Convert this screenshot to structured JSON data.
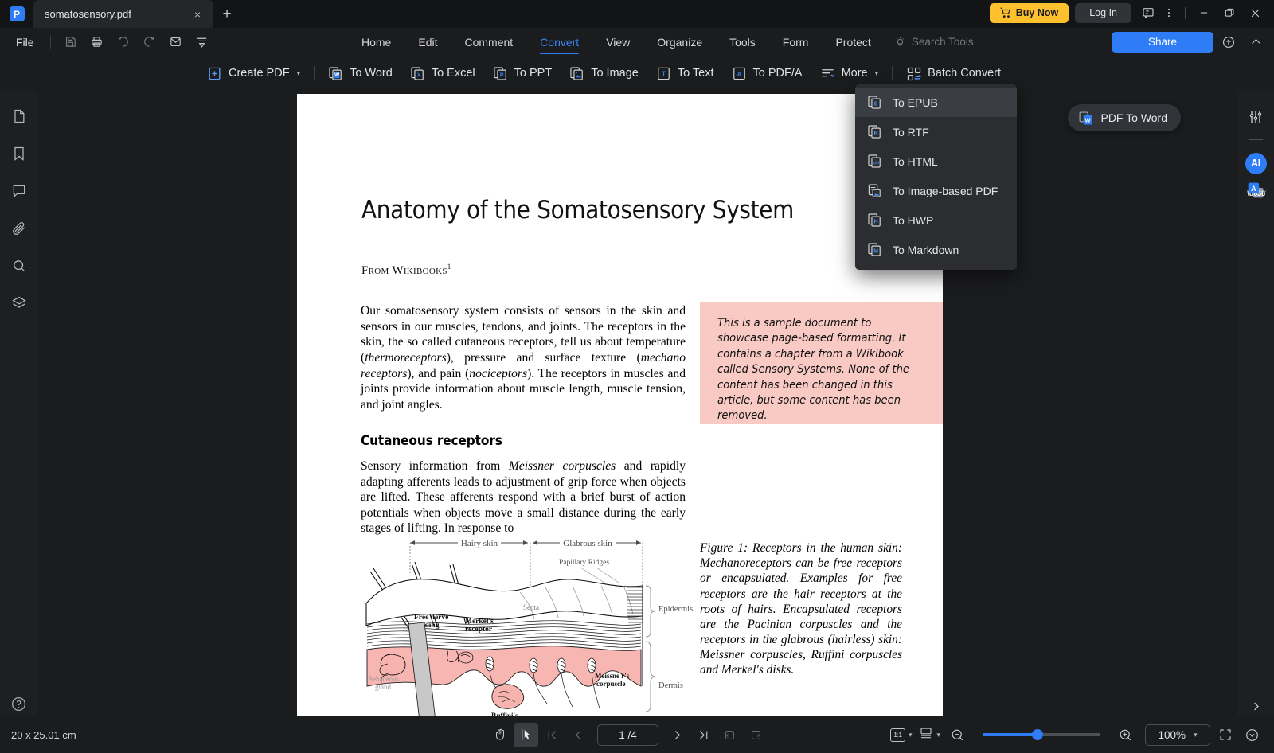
{
  "titlebar": {
    "app_logo": "pdfelement-logo-icon",
    "tab_title": "somatosensory.pdf",
    "tab_close": "×",
    "new_tab": "+",
    "buy_now": "Buy Now",
    "log_in": "Log In",
    "feedback_icon": "feedback-icon",
    "more_icon": "more-vertical-icon",
    "minimize": "−",
    "restore": "restore-icon",
    "close": "×"
  },
  "ribbon": {
    "file": "File",
    "quick_icons": [
      "save-icon",
      "print-icon",
      "undo-icon",
      "redo-icon",
      "email-icon",
      "customize-icon"
    ],
    "menus": [
      {
        "label": "Home",
        "selected": false
      },
      {
        "label": "Edit",
        "selected": false
      },
      {
        "label": "Comment",
        "selected": false
      },
      {
        "label": "Convert",
        "selected": true
      },
      {
        "label": "View",
        "selected": false
      },
      {
        "label": "Organize",
        "selected": false
      },
      {
        "label": "Tools",
        "selected": false
      },
      {
        "label": "Form",
        "selected": false
      },
      {
        "label": "Protect",
        "selected": false
      }
    ],
    "search_placeholder": "Search Tools",
    "search_icon": "lightbulb-icon",
    "share": "Share",
    "cloud_icon": "cloud-upload-icon",
    "collapse_icon": "chevron-up-icon"
  },
  "convert_toolbar": {
    "items": [
      {
        "label": "Create PDF",
        "icon": "plus-square-icon",
        "caret": true
      },
      {
        "label": "To Word",
        "icon": "word-icon",
        "caret": false
      },
      {
        "label": "To Excel",
        "icon": "excel-icon",
        "caret": false
      },
      {
        "label": "To PPT",
        "icon": "powerpoint-icon",
        "caret": false
      },
      {
        "label": "To Image",
        "icon": "image-icon",
        "caret": false
      },
      {
        "label": "To Text",
        "icon": "text-icon",
        "caret": false
      },
      {
        "label": "To PDF/A",
        "icon": "pdfa-icon",
        "caret": false
      },
      {
        "label": "More",
        "icon": "more-lines-icon",
        "caret": true
      },
      {
        "label": "Batch Convert",
        "icon": "batch-convert-icon",
        "caret": false
      }
    ]
  },
  "more_dropdown": {
    "open": true,
    "items": [
      {
        "label": "To EPUB",
        "icon": "epub-icon",
        "highlighted": true
      },
      {
        "label": "To RTF",
        "icon": "rtf-icon",
        "highlighted": false
      },
      {
        "label": "To HTML",
        "icon": "html-icon",
        "highlighted": false
      },
      {
        "label": "To Image-based PDF",
        "icon": "image-pdf-icon",
        "highlighted": false
      },
      {
        "label": "To HWP",
        "icon": "hwp-icon",
        "highlighted": false
      },
      {
        "label": "To Markdown",
        "icon": "markdown-icon",
        "highlighted": false
      }
    ]
  },
  "left_rail": {
    "items": [
      {
        "name": "thumbnails-icon"
      },
      {
        "name": "bookmark-icon"
      },
      {
        "name": "comment-icon"
      },
      {
        "name": "attachment-icon"
      },
      {
        "name": "search-icon"
      },
      {
        "name": "layers-icon"
      }
    ],
    "help_icon": "help-circle-icon",
    "collapse_icon": "chevron-left-icon"
  },
  "right_rail": {
    "settings_icon": "sliders-icon",
    "ai_label": "AI",
    "translate_icon": "translate-icon",
    "expand_icon": "chevron-right-icon"
  },
  "floating_action": {
    "label": "PDF To Word",
    "icon": "word-convert-icon"
  },
  "document": {
    "title": "Anatomy of the Somatosensory System",
    "byline": "From Wikibooks",
    "byline_superscript": "1",
    "paragraph_1": "Our somatosensory system consists of sensors in the skin and sensors in our muscles, tendons, and joints. The receptors in the skin, the so called cutaneous receptors, tell us about temperature (thermoreceptors), pressure and surface texture (mechano receptors), and pain (nociceptors). The receptors in muscles and joints provide information about muscle length, muscle tension, and joint angles.",
    "section_heading": "Cutaneous receptors",
    "paragraph_2": "Sensory information from Meissner corpuscles and rapidly adapting afferents leads to adjustment of grip force when objects are lifted. These afferents respond with a brief burst of action potentials when objects move a small distance during the early stages of lifting. In response to",
    "note_box": {
      "text": "This is a sample document to showcase page-based formatting. It contains a chapter from a Wikibook called Sensory Systems. None of the content has been changed in this article, but some content has been removed.",
      "background": "#f9cac4"
    },
    "figure_caption": "Figure 1: Receptors in the human skin: Mechanoreceptors can be free receptors or encapsulated. Examples for free receptors are the hair receptors at the roots of hairs. Encapsulated receptors are the Pacinian corpuscles and the receptors in the glabrous (hairless) skin: Meissner corpuscles, Ruffini corpuscles and Merkel's disks.",
    "figure_labels": {
      "hairy_skin": "Hairy skin",
      "glabrous_skin": "Glabrous skin",
      "papillary_ridges": "Papillary Ridges",
      "septa": "Septa",
      "free_nerve_ending": "Free nerve ending",
      "merkels_receptor": "Merkel's receptor",
      "epidermis": "Epidermis",
      "dermis": "Dermis",
      "sebaceous_gland": "Sebaceous gland",
      "ruffinis_corpuscle": "Ruffini's corpuscle",
      "meissners_corpuscle": "Meissne r's corpuscle"
    }
  },
  "statusbar": {
    "page_size": "20 x 25.01 cm",
    "hand_tool": "hand-tool-icon",
    "select_tool": "select-tool-icon",
    "first_page": "first-page-icon",
    "prev_page": "prev-page-icon",
    "page_value": "1 /4",
    "next_page": "next-page-icon",
    "last_page": "last-page-icon",
    "rotate_left": "rotate-left-icon",
    "rotate_right": "rotate-right-icon",
    "fit_mode": "1:1",
    "view_mode_icon": "page-layout-icon",
    "zoom_out": "zoom-out-icon",
    "zoom_in": "zoom-in-icon",
    "zoom_level": "100%",
    "fullscreen_icon": "fullscreen-icon",
    "more_view_icon": "chevron-down-circle-icon"
  },
  "colors": {
    "accent": "#2f7df6",
    "buy_now": "#ffc02e",
    "window_bg": "#1b1c1e",
    "titlebar_bg": "#131416",
    "tab_bg": "#242629",
    "menu_bg": "#2b2d31",
    "note_pink": "#f9cac4"
  }
}
